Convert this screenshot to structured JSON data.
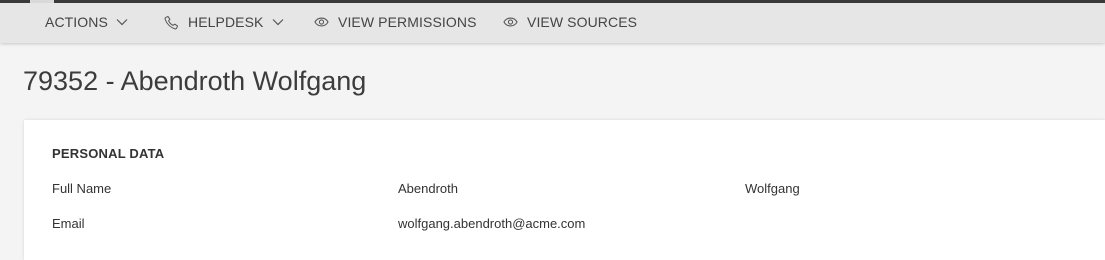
{
  "toolbar": {
    "actions_label": "ACTIONS",
    "helpdesk_label": "HELPDESK",
    "view_permissions_label": "VIEW PERMISSIONS",
    "view_sources_label": "VIEW SOURCES"
  },
  "page": {
    "title": "79352 - Abendroth Wolfgang"
  },
  "personal_data": {
    "section_title": "PERSONAL DATA",
    "rows": [
      {
        "label": "Full Name",
        "values": [
          "Abendroth",
          "Wolfgang"
        ]
      },
      {
        "label": "Email",
        "values": [
          "wolfgang.abendroth@acme.com"
        ]
      }
    ]
  },
  "icons": [
    "chevron-down-icon",
    "phone-icon",
    "eye-icon"
  ],
  "colors": {
    "toolbar_bg": "#e6e6e6",
    "page_bg": "#f4f4f4",
    "card_bg": "#ffffff",
    "text": "#333333"
  }
}
